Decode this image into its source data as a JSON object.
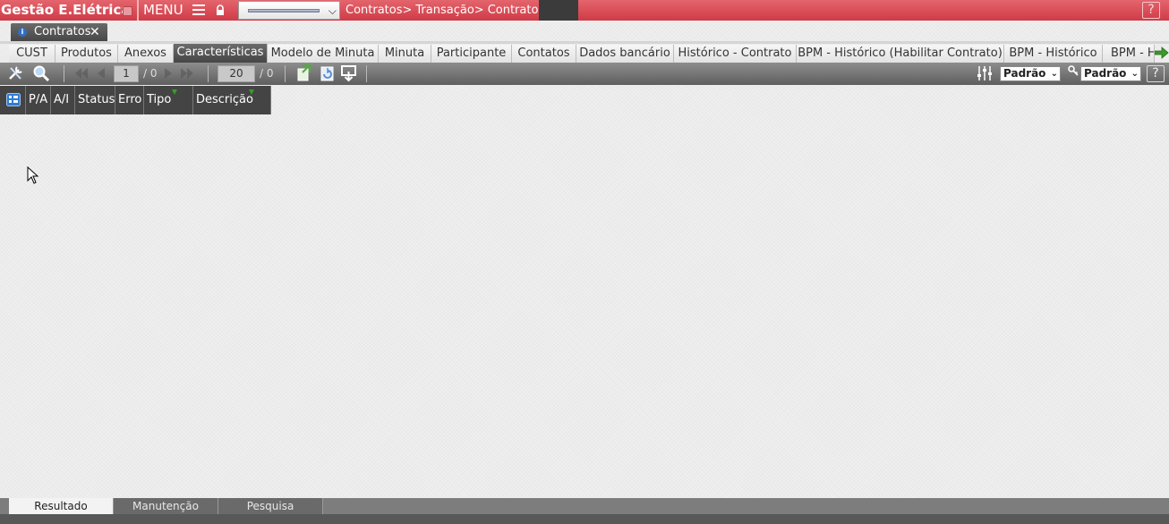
{
  "app": {
    "title": "Gestão E.Elétrica",
    "menu_label": "MENU"
  },
  "breadcrumb": [
    "Contratos>",
    "Transação>",
    "Contratos>"
  ],
  "help_label": "?",
  "page_tab": {
    "label": "Contratos",
    "close": "✕"
  },
  "subtabs": [
    {
      "label": "CUST"
    },
    {
      "label": "Produtos"
    },
    {
      "label": "Anexos"
    },
    {
      "label": "Características",
      "active": true
    },
    {
      "label": "Modelo de Minuta"
    },
    {
      "label": "Minuta"
    },
    {
      "label": "Participante"
    },
    {
      "label": "Contatos"
    },
    {
      "label": "Dados bancário"
    },
    {
      "label": "Histórico - Contrato"
    },
    {
      "label": "BPM - Histórico (Habilitar Contrato)"
    },
    {
      "label": "BPM - Histórico"
    },
    {
      "label": "BPM - H"
    }
  ],
  "toolbar": {
    "page_current": "1",
    "page_total": "/ 0",
    "page_size": "20",
    "rows_total": "/ 0",
    "view_select": "Padrão",
    "layout_select": "Padrão"
  },
  "grid": {
    "columns": [
      "P/A",
      "A/I",
      "Status",
      "Erro",
      "Tipo",
      "Descrição"
    ]
  },
  "bottom_tabs": [
    {
      "label": "Resultado",
      "active": true
    },
    {
      "label": "Manutenção"
    },
    {
      "label": "Pesquisa"
    }
  ],
  "colors": {
    "topbar": "#d9464f",
    "toolbar": "#6e6e6e",
    "header": "#444444",
    "accent_green": "#3a9a2a"
  }
}
